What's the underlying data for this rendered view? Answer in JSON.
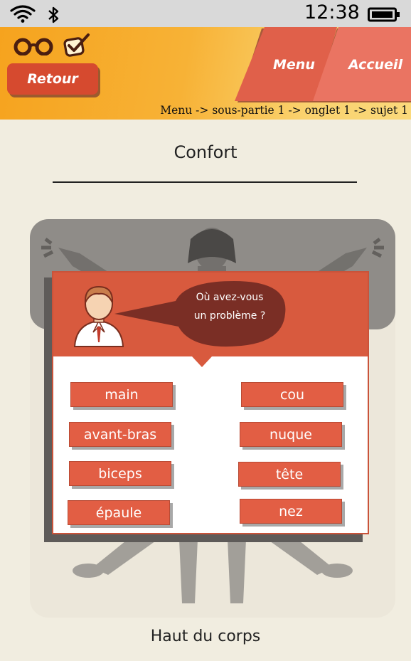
{
  "status_bar": {
    "time": "12:38"
  },
  "header": {
    "back_label": "Retour",
    "menu_label": "Menu",
    "home_label": "Accueil",
    "breadcrumb": "Menu -> sous-partie 1 -> onglet 1 -> sujet 1"
  },
  "page": {
    "title": "Confort",
    "footer": "Haut du corps"
  },
  "dialog": {
    "question_line1": "Où avez-vous",
    "question_line2": "un problème  ?",
    "options_left": [
      "main",
      "avant-bras",
      "biceps",
      "épaule"
    ],
    "options_right": [
      "cou",
      "nuque",
      "tête",
      "nez"
    ]
  },
  "colors": {
    "accent": "#e25e44",
    "header_orange": "#f6a31e",
    "tab_red": "#e0604a",
    "background": "#f1ede0"
  }
}
